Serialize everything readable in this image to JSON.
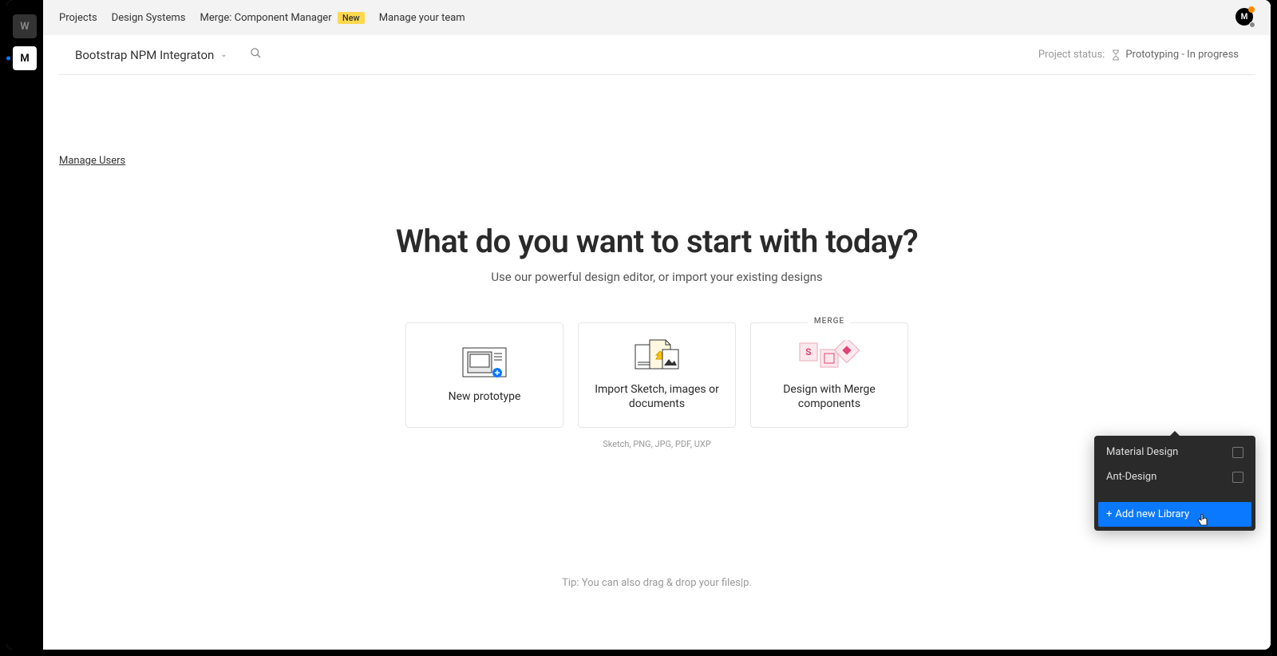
{
  "rail": {
    "item1": "W",
    "item2": "M"
  },
  "topnav": {
    "projects": "Projects",
    "design_systems": "Design Systems",
    "merge": "Merge: Component Manager",
    "merge_badge": "New",
    "manage_team": "Manage your team",
    "avatar_initial": "M"
  },
  "subnav": {
    "project_title": "Bootstrap NPM Integraton",
    "status_label": "Project status:",
    "status_value": "Prototyping - In progress"
  },
  "content": {
    "manage_users": "Manage Users",
    "hero_title": "What do you want to start with today?",
    "hero_sub": "Use our powerful design editor, or import your existing designs",
    "card1": "New prototype",
    "card2": "Import Sketch, images or documents",
    "formats": "Sketch, PNG, JPG, PDF, UXP",
    "card3_badge": "MERGE",
    "card3": "Design with Merge components",
    "tip": "Tip: You can also drag & drop your files|p."
  },
  "dropdown": {
    "item1": "Material Design",
    "item2": "Ant-Design",
    "add": "Add new Library"
  }
}
